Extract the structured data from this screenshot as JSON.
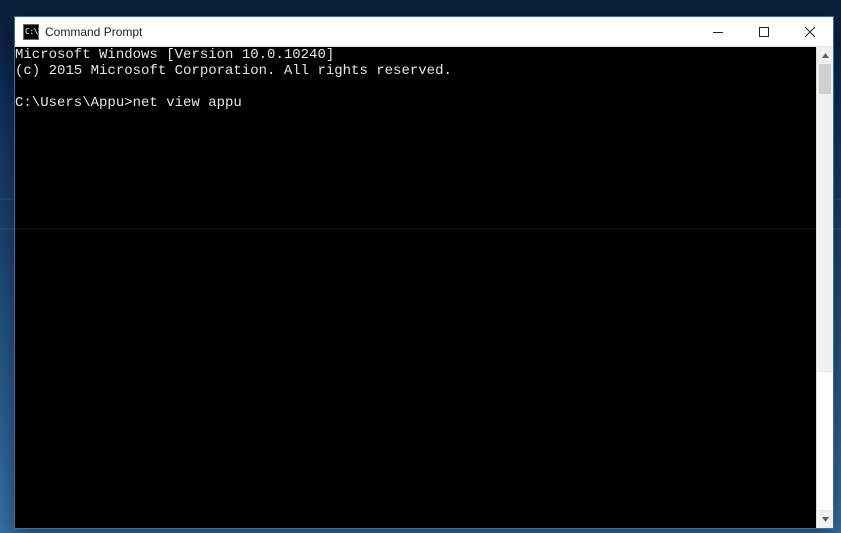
{
  "window": {
    "title": "Command Prompt"
  },
  "terminal": {
    "lines": [
      "Microsoft Windows [Version 10.0.10240]",
      "(c) 2015 Microsoft Corporation. All rights reserved.",
      "",
      "C:\\Users\\Appu>net view appu"
    ]
  }
}
